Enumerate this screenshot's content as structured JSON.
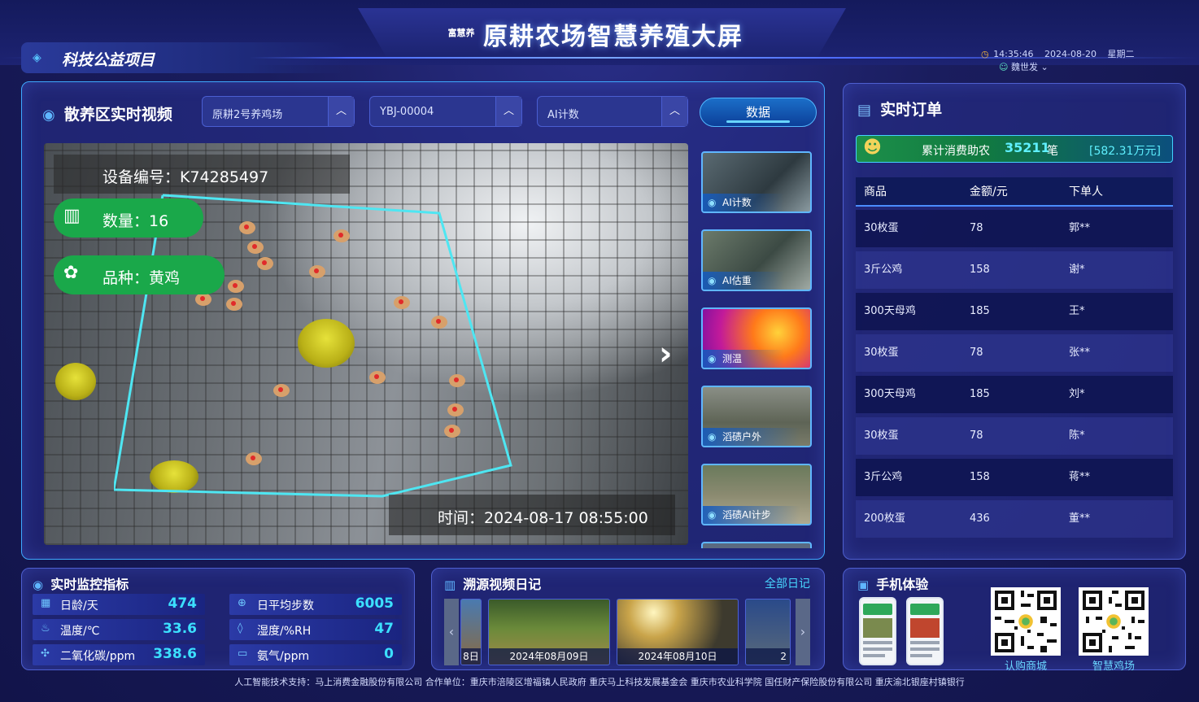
{
  "header": {
    "logo_text": "富慧养",
    "title": "原耕农场智慧养殖大屏",
    "project_tag": "科技公益项目",
    "time": "14:35:46",
    "date": "2024-08-20",
    "weekday": "星期二",
    "user": "魏世发"
  },
  "video": {
    "title": "散养区实时视频",
    "select_farm": "原耕2号养鸡场",
    "select_device": "YBJ-00004",
    "select_mode": "AI计数",
    "data_button": "数据",
    "overlay_device": "设备编号：K74285497",
    "overlay_count": "数量：16",
    "overlay_breed": "品种：黄鸡",
    "overlay_time": "时间：2024-08-17 08:55:00",
    "thumbnails": [
      {
        "label": "AI计数"
      },
      {
        "label": "AI估重"
      },
      {
        "label": "测温"
      },
      {
        "label": "滔碛户外"
      },
      {
        "label": "滔碛AI计步"
      }
    ]
  },
  "orders": {
    "title": "实时订单",
    "summary_prefix": "累计消费助农",
    "summary_count": "35211",
    "summary_unit": "笔",
    "summary_amount": "[582.31万元]",
    "columns": [
      "商品",
      "金额/元",
      "下单人"
    ],
    "rows": [
      {
        "item": "30枚蛋",
        "amount": "78",
        "buyer": "郭**"
      },
      {
        "item": "3斤公鸡",
        "amount": "158",
        "buyer": "谢*"
      },
      {
        "item": "300天母鸡",
        "amount": "185",
        "buyer": "王*"
      },
      {
        "item": "30枚蛋",
        "amount": "78",
        "buyer": "张**"
      },
      {
        "item": "300天母鸡",
        "amount": "185",
        "buyer": "刘*"
      },
      {
        "item": "30枚蛋",
        "amount": "78",
        "buyer": "陈*"
      },
      {
        "item": "3斤公鸡",
        "amount": "158",
        "buyer": "蒋**"
      },
      {
        "item": "200枚蛋",
        "amount": "436",
        "buyer": "董**"
      }
    ]
  },
  "monitor": {
    "title": "实时监控指标",
    "metrics": [
      {
        "label": "日龄/天",
        "value": "474"
      },
      {
        "label": "日平均步数",
        "value": "6005"
      },
      {
        "label": "温度/℃",
        "value": "33.6"
      },
      {
        "label": "湿度/%RH",
        "value": "47"
      },
      {
        "label": "二氧化碳/ppm",
        "value": "338.6"
      },
      {
        "label": "氨气/ppm",
        "value": "0"
      }
    ]
  },
  "diary": {
    "title": "溯源视频日记",
    "all_link": "全部日记",
    "frames": [
      {
        "label": "8日"
      },
      {
        "label": "2024年08月09日"
      },
      {
        "label": "2024年08月10日"
      },
      {
        "label": "2"
      }
    ]
  },
  "mobile": {
    "title": "手机体验",
    "qr1_label": "认购商城",
    "qr2_label": "智慧鸡场"
  },
  "footer": {
    "text": "人工智能技术支持：马上消费金融股份有限公司 合作单位：重庆市涪陵区增福镇人民政府 重庆马上科技发展基金会 重庆市农业科学院 国任财产保险股份有限公司 重庆渝北银座村镇银行"
  }
}
